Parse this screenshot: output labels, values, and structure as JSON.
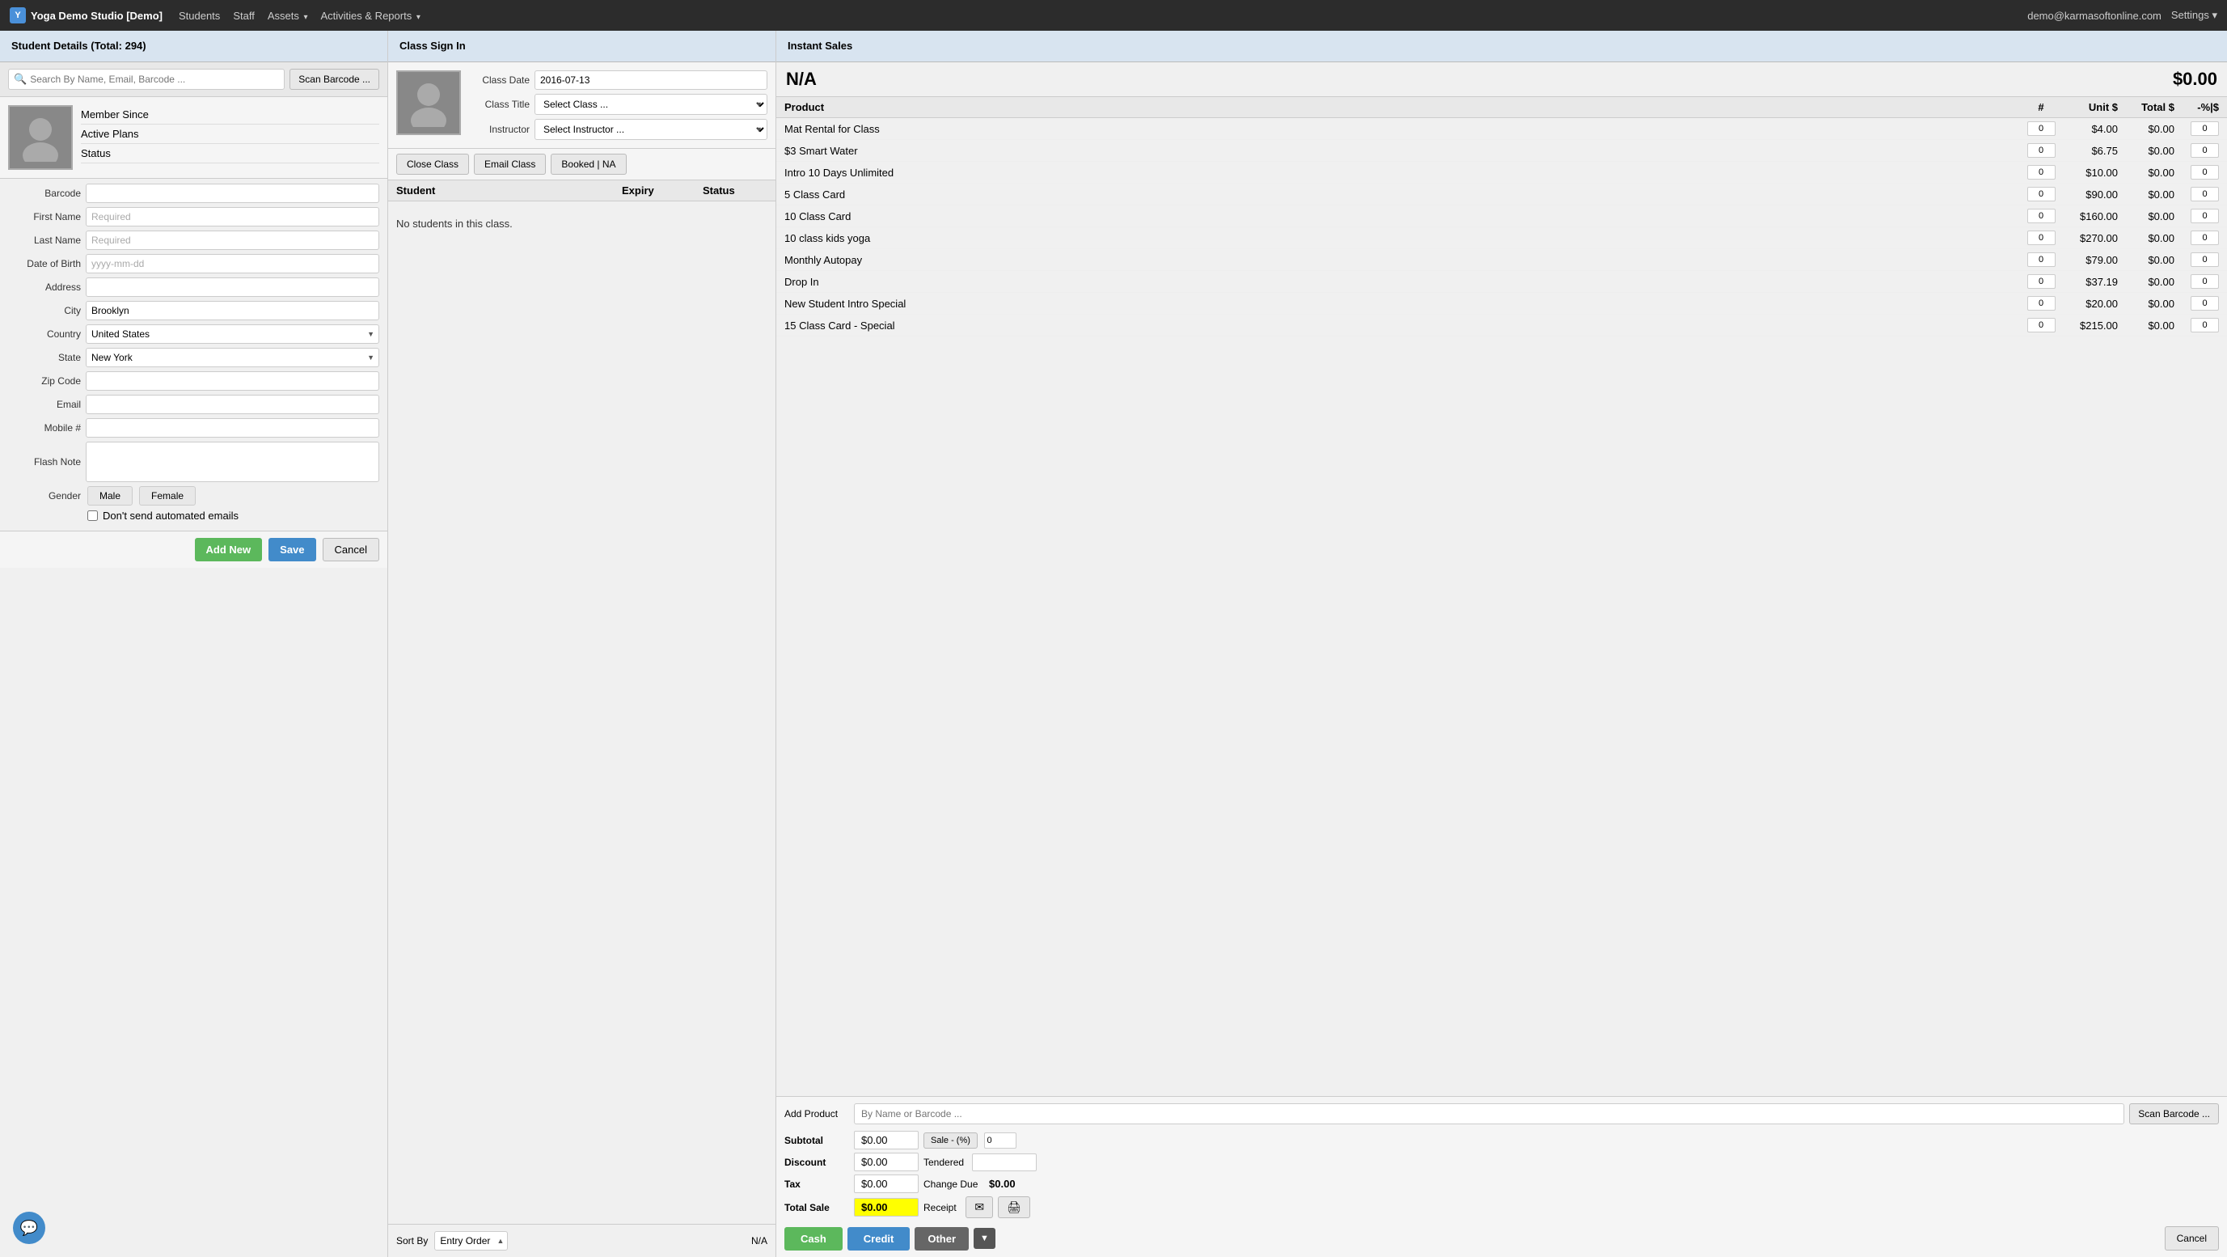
{
  "app": {
    "title": "Yoga Demo Studio [Demo]",
    "brand_icon": "Y"
  },
  "nav": {
    "links": [
      {
        "label": "Students",
        "has_arrow": false
      },
      {
        "label": "Staff",
        "has_arrow": false
      },
      {
        "label": "Assets",
        "has_arrow": true
      },
      {
        "label": "Activities & Reports",
        "has_arrow": true
      }
    ],
    "user_email": "demo@karmasoftonline.com",
    "settings_label": "Settings"
  },
  "student_details": {
    "panel_title": "Student Details (Total: 294)",
    "search_placeholder": "Search By Name, Email, Barcode ...",
    "scan_barcode_label": "Scan Barcode ...",
    "info_rows": [
      {
        "label": "Member Since"
      },
      {
        "label": "Active Plans"
      },
      {
        "label": "Status"
      }
    ],
    "fields": {
      "barcode_label": "Barcode",
      "barcode_value": "",
      "firstname_label": "First Name",
      "firstname_placeholder": "Required",
      "lastname_label": "Last Name",
      "lastname_placeholder": "Required",
      "dob_label": "Date of Birth",
      "dob_placeholder": "yyyy-mm-dd",
      "address_label": "Address",
      "address_value": "",
      "city_label": "City",
      "city_value": "Brooklyn",
      "country_label": "Country",
      "country_value": "United States",
      "state_label": "State",
      "state_value": "New York",
      "zipcode_label": "Zip Code",
      "zipcode_value": "",
      "email_label": "Email",
      "email_value": "",
      "mobile_label": "Mobile #",
      "mobile_value": "",
      "flash_label": "Flash Note",
      "flash_value": "",
      "gender_label": "Gender",
      "gender_male": "Male",
      "gender_female": "Female",
      "no_email_label": "Don't send automated emails"
    },
    "buttons": {
      "add_new": "Add New",
      "save": "Save",
      "cancel": "Cancel"
    }
  },
  "class_sign_in": {
    "panel_title": "Class Sign In",
    "class_date_label": "Class Date",
    "class_date_value": "2016-07-13",
    "class_title_label": "Class Title",
    "class_title_placeholder": "Select Class ...",
    "instructor_label": "Instructor",
    "instructor_placeholder": "Select Instructor ...",
    "buttons": {
      "close_class": "Close Class",
      "email_class": "Email Class",
      "booked": "Booked | NA"
    },
    "table_headers": {
      "student": "Student",
      "expiry": "Expiry",
      "status": "Status"
    },
    "no_students_message": "No students in this class.",
    "sort_label": "Sort By",
    "sort_options": [
      {
        "value": "entry_order",
        "label": "Entry Order"
      }
    ],
    "sort_na": "N/A"
  },
  "instant_sales": {
    "panel_title": "Instant Sales",
    "customer_na": "N/A",
    "total_display": "$0.00",
    "table_headers": {
      "product": "Product",
      "hash": "#",
      "unit": "Unit $",
      "total": "Total $",
      "pct": "-%|$"
    },
    "products": [
      {
        "name": "Mat Rental for Class",
        "qty": "0",
        "unit": "$4.00",
        "total": "$0.00",
        "pct": "0"
      },
      {
        "name": "$3 Smart Water",
        "qty": "0",
        "unit": "$6.75",
        "total": "$0.00",
        "pct": "0"
      },
      {
        "name": "Intro 10 Days Unlimited",
        "qty": "0",
        "unit": "$10.00",
        "total": "$0.00",
        "pct": "0"
      },
      {
        "name": "5 Class Card",
        "qty": "0",
        "unit": "$90.00",
        "total": "$0.00",
        "pct": "0"
      },
      {
        "name": "10 Class Card",
        "qty": "0",
        "unit": "$160.00",
        "total": "$0.00",
        "pct": "0"
      },
      {
        "name": "10 class kids yoga",
        "qty": "0",
        "unit": "$270.00",
        "total": "$0.00",
        "pct": "0"
      },
      {
        "name": "Monthly Autopay",
        "qty": "0",
        "unit": "$79.00",
        "total": "$0.00",
        "pct": "0"
      },
      {
        "name": "Drop In",
        "qty": "0",
        "unit": "$37.19",
        "total": "$0.00",
        "pct": "0"
      },
      {
        "name": "New Student Intro Special",
        "qty": "0",
        "unit": "$20.00",
        "total": "$0.00",
        "pct": "0"
      },
      {
        "name": "15 Class Card - Special",
        "qty": "0",
        "unit": "$215.00",
        "total": "$0.00",
        "pct": "0"
      }
    ],
    "add_product_label": "Add Product",
    "add_product_placeholder": "By Name or Barcode ...",
    "scan_barcode_label": "Scan Barcode ...",
    "subtotal_label": "Subtotal",
    "subtotal_value": "$0.00",
    "sale_pct_btn": "Sale - (%)",
    "sale_pct_value": "0",
    "discount_label": "Discount",
    "discount_value": "$0.00",
    "tendered_label": "Tendered",
    "tendered_value": "",
    "tax_label": "Tax",
    "tax_value": "$0.00",
    "change_due_label": "Change Due",
    "change_due_value": "$0.00",
    "total_sale_label": "Total Sale",
    "total_sale_value": "$0.00",
    "receipt_label": "Receipt",
    "payment_buttons": {
      "cash": "Cash",
      "credit": "Credit",
      "other": "Other",
      "cancel": "Cancel"
    }
  }
}
